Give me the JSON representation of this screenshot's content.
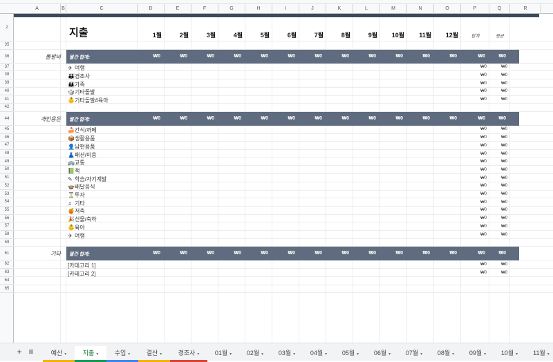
{
  "columns": [
    "A",
    "B",
    "C",
    "D",
    "E",
    "F",
    "G",
    "H",
    "I",
    "J",
    "K",
    "L",
    "M",
    "N",
    "O",
    "P",
    "Q",
    "R"
  ],
  "row_numbers": [
    "2",
    "35",
    "36",
    "37",
    "38",
    "39",
    "40",
    "41",
    "42",
    "44",
    "45",
    "46",
    "47",
    "48",
    "49",
    "50",
    "51",
    "52",
    "53",
    "54",
    "55",
    "56",
    "57",
    "58",
    "59",
    "61",
    "62",
    "63",
    "64",
    "65"
  ],
  "sheet_title": "지출",
  "months": [
    "1월",
    "2월",
    "3월",
    "4월",
    "5월",
    "6월",
    "7월",
    "8월",
    "9월",
    "10월",
    "11월",
    "12월"
  ],
  "sum_label": "합계",
  "avg_label": "평균",
  "zero": "₩0",
  "sections": [
    {
      "label": "돌발비",
      "header": "월간 합계:",
      "items": [
        {
          "icon": "plane-icon",
          "glyph": "✈",
          "name": "여행"
        },
        {
          "icon": "family-icon",
          "glyph": "👪",
          "name": "경조사"
        },
        {
          "icon": "family-icon",
          "glyph": "👪",
          "name": "가족"
        },
        {
          "icon": "misc-icon",
          "glyph": "🎲",
          "name": "기타돌발"
        },
        {
          "icon": "baby-icon",
          "glyph": "👶",
          "name": "기타돌발#육아"
        }
      ]
    },
    {
      "label": "개인용돈",
      "header": "월간 합계:",
      "items": [
        {
          "icon": "cake-icon",
          "glyph": "🍰",
          "name": "간식/까페"
        },
        {
          "icon": "box-icon",
          "glyph": "📦",
          "name": "생활용품"
        },
        {
          "icon": "person-icon",
          "glyph": "👤",
          "name": "남편용품"
        },
        {
          "icon": "dress-icon",
          "glyph": "👗",
          "name": "패션/미용"
        },
        {
          "icon": "bus-icon",
          "glyph": "🚌",
          "name": "교통"
        },
        {
          "icon": "book-icon",
          "glyph": "📗",
          "name": "책"
        },
        {
          "icon": "pen-icon",
          "glyph": "✎",
          "name": "학습/자기계발"
        },
        {
          "icon": "food-icon",
          "glyph": "🍲",
          "name": "배달음식"
        },
        {
          "icon": "hourglass-icon",
          "glyph": "⌛",
          "name": "투자"
        },
        {
          "icon": "music-icon",
          "glyph": "♫",
          "name": "기타"
        },
        {
          "icon": "pot-icon",
          "glyph": "🍯",
          "name": "저축"
        },
        {
          "icon": "gift-icon",
          "glyph": "🎉",
          "name": "선물/축하"
        },
        {
          "icon": "baby-icon",
          "glyph": "👶",
          "name": "육아"
        },
        {
          "icon": "plane-icon",
          "glyph": "✈",
          "name": "여행"
        }
      ]
    },
    {
      "label": "기타",
      "header": "월간 합계:",
      "items": [
        {
          "icon": "",
          "glyph": "",
          "name": "[카테고리 1]"
        },
        {
          "icon": "",
          "glyph": "",
          "name": "[카테고리 2]"
        }
      ]
    }
  ],
  "tabs": [
    {
      "label": "예산",
      "color": "#f4b400"
    },
    {
      "label": "지출",
      "color": "#0f9d58",
      "active": true
    },
    {
      "label": "수입",
      "color": "#4285f4"
    },
    {
      "label": "결산",
      "color": "#f4b400"
    },
    {
      "label": "경조사",
      "color": "#db4437"
    },
    {
      "label": "01월",
      "color": ""
    },
    {
      "label": "02월",
      "color": ""
    },
    {
      "label": "03월",
      "color": ""
    },
    {
      "label": "04월",
      "color": ""
    },
    {
      "label": "05월",
      "color": ""
    },
    {
      "label": "06월",
      "color": ""
    },
    {
      "label": "07월",
      "color": ""
    },
    {
      "label": "08월",
      "color": ""
    },
    {
      "label": "09월",
      "color": ""
    },
    {
      "label": "10월",
      "color": ""
    },
    {
      "label": "11월",
      "color": ""
    }
  ],
  "colors": {
    "header_bg": "#5f6b7e",
    "dark_bar": "#3c4a5c",
    "active_tab": "#188038"
  }
}
